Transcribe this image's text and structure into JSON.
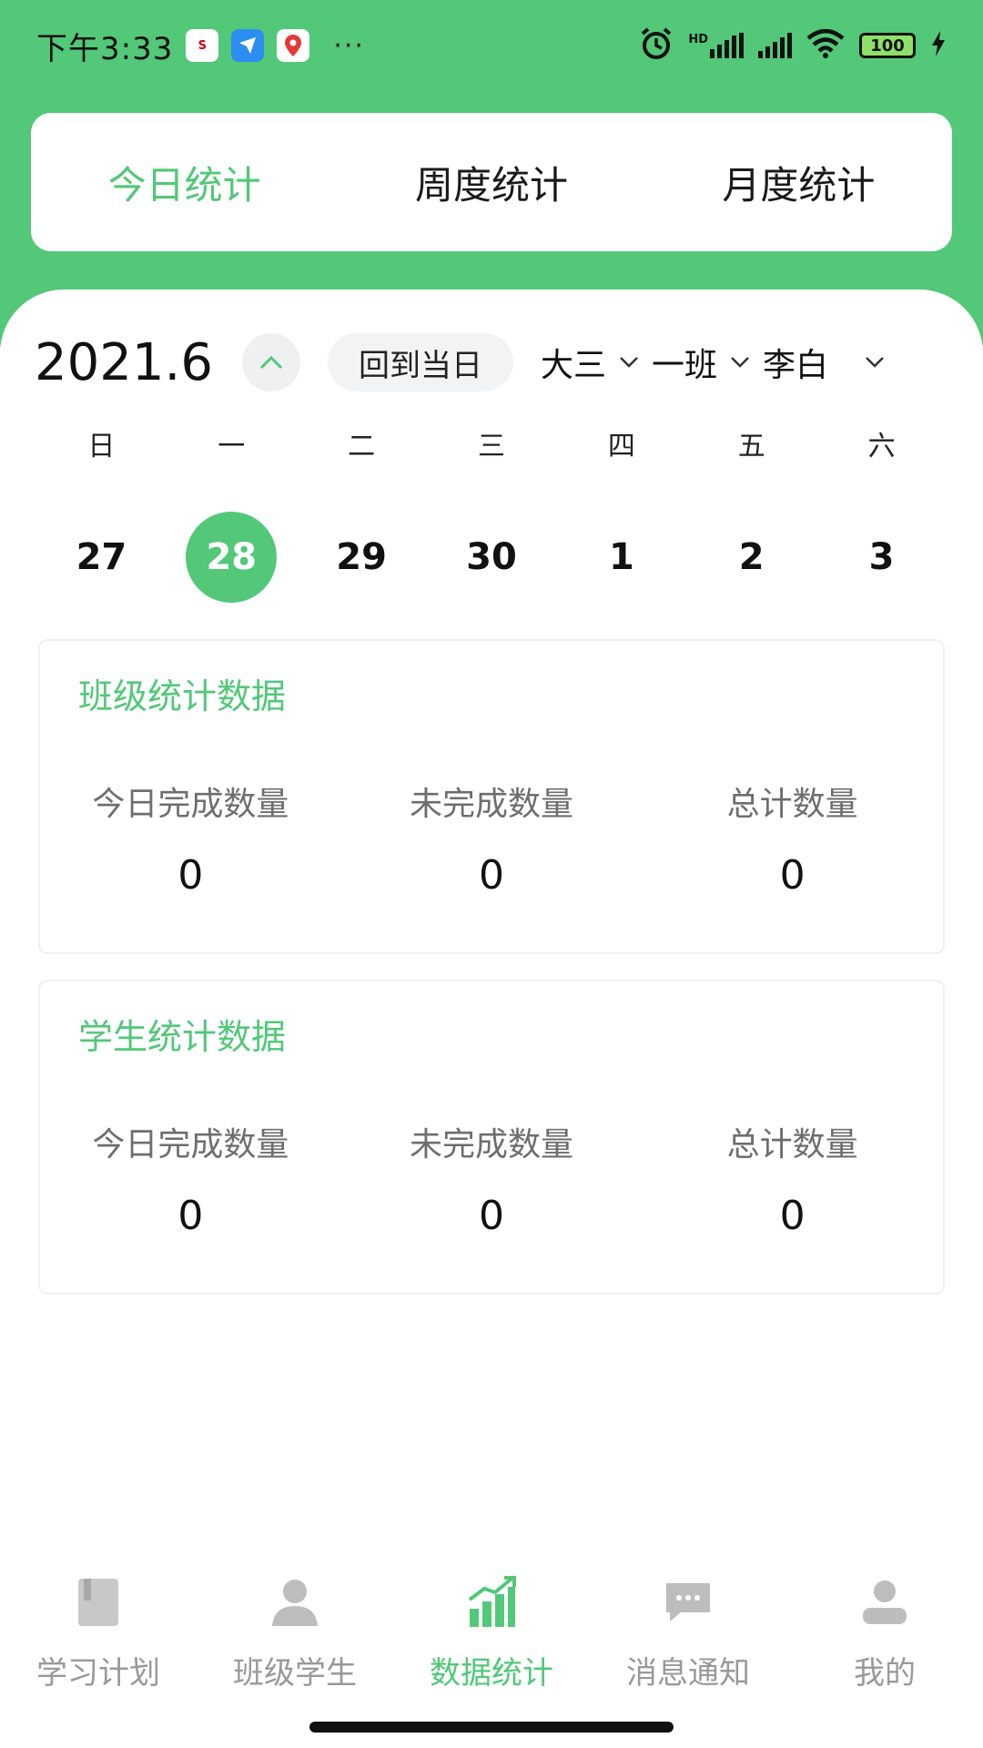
{
  "status_bar": {
    "time": "下午3:33",
    "battery": "100",
    "network_badge": "HD"
  },
  "tabs": [
    {
      "label": "今日统计",
      "active": true
    },
    {
      "label": "周度统计",
      "active": false
    },
    {
      "label": "月度统计",
      "active": false
    }
  ],
  "calendar": {
    "year_month": "2021.6",
    "today_button": "回到当日",
    "filters": {
      "grade": "大三",
      "class": "一班",
      "student": "李白"
    },
    "weekdays": [
      "日",
      "一",
      "二",
      "三",
      "四",
      "五",
      "六"
    ],
    "days": [
      "27",
      "28",
      "29",
      "30",
      "1",
      "2",
      "3"
    ],
    "selected_day": "28"
  },
  "class_stats": {
    "title": "班级统计数据",
    "items": [
      {
        "label": "今日完成数量",
        "value": "0"
      },
      {
        "label": "未完成数量",
        "value": "0"
      },
      {
        "label": "总计数量",
        "value": "0"
      }
    ]
  },
  "student_stats": {
    "title": "学生统计数据",
    "items": [
      {
        "label": "今日完成数量",
        "value": "0"
      },
      {
        "label": "未完成数量",
        "value": "0"
      },
      {
        "label": "总计数量",
        "value": "0"
      }
    ]
  },
  "bottom_nav": [
    {
      "label": "学习计划",
      "icon": "book-icon",
      "active": false
    },
    {
      "label": "班级学生",
      "icon": "user-icon",
      "active": false
    },
    {
      "label": "数据统计",
      "icon": "chart-icon",
      "active": true
    },
    {
      "label": "消息通知",
      "icon": "message-icon",
      "active": false
    },
    {
      "label": "我的",
      "icon": "profile-icon",
      "active": false
    }
  ],
  "colors": {
    "accent": "#52c878",
    "inactive": "#999999"
  }
}
